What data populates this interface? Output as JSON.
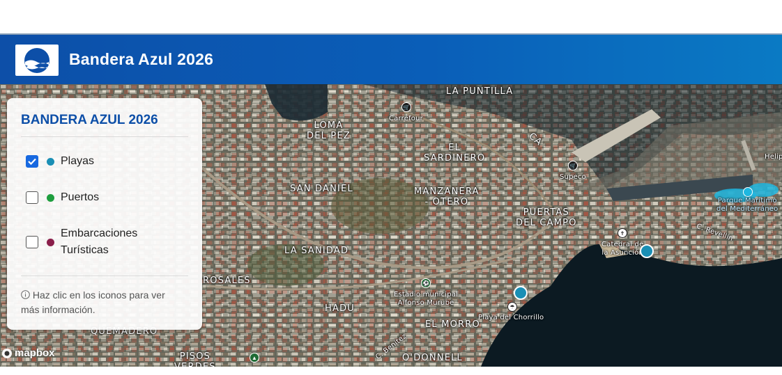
{
  "header": {
    "title": "Bandera Azul 2026"
  },
  "panel": {
    "title": "BANDERA AZUL 2026",
    "layers": [
      {
        "label": "Playas",
        "checked": true,
        "color": "#1a8fb5"
      },
      {
        "label": "Puertos",
        "checked": false,
        "color": "#1e9e3e"
      },
      {
        "label": "Embarcaciones Turísticas",
        "checked": false,
        "color": "#8a1e4a"
      }
    ],
    "hint_icon": "info-icon",
    "hint": "Haz clic en los iconos para ver más información."
  },
  "map": {
    "attribution": "mapbox",
    "labels": {
      "la_puntilla": "LA PUNTILLA",
      "loma_del_pez": "LOMA\nDEL PEZ",
      "el_sardinero": "EL\nSARDINERO",
      "san_daniel": "SAN DANIEL",
      "manzanera_otero": "MANZANERA\n- OTERO",
      "puertas_del_campo": "PUERTAS\nDEL CAMPO",
      "la_sanidad": "LA SANIDAD",
      "rosales": "ROSALES",
      "hadu": "HADU",
      "el_morro": "EL MORRO",
      "quemadero": "QUEMADERO",
      "pisos_verdes": "PISOS\nVERDES",
      "o_donnell": "O'DONNELL",
      "ca": "CA",
      "c_benitez": "C. Benítez",
      "c_revellin": "C. Revellín"
    },
    "pois": {
      "carrefour": "Carrefour",
      "supeco": "Supeco",
      "catedral": "Catedral de\nla Asunción",
      "estadio": "Estadio municipal\nAlfonso Murube",
      "playa_chorrillo": "Playa del Chorrillo",
      "parque_maritimo": "Parque Marítimo\ndel Mediterráneo",
      "heli": "Helip"
    }
  }
}
